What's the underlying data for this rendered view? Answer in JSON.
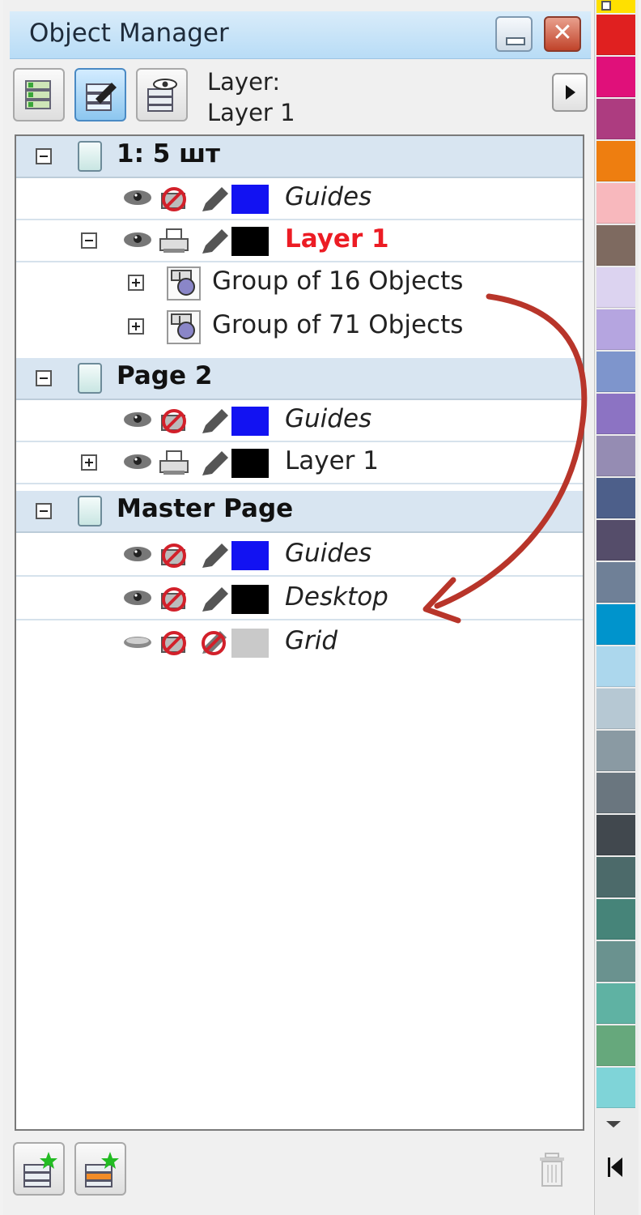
{
  "panel": {
    "title": "Object Manager",
    "close_glyph": "✕",
    "layer_prefix": "Layer:",
    "current_layer": "Layer 1"
  },
  "pages": [
    {
      "label": "1: 5 шт"
    },
    {
      "label": "Page 2"
    },
    {
      "label": "Master Page"
    }
  ],
  "layers": {
    "p1_guides": "Guides",
    "p1_layer1": "Layer 1",
    "p1_group1": "Group of 16 Objects",
    "p1_group2": "Group of 71 Objects",
    "p2_guides": "Guides",
    "p2_layer1": "Layer 1",
    "m_guides": "Guides",
    "m_desktop": "Desktop",
    "m_grid": "Grid"
  },
  "colors": {
    "guides_swatch": "#1212f2",
    "layer_swatch": "#000000",
    "grid_swatch": "#c9c9c9",
    "active_layer_text": "#ec1c24",
    "annotation_arrow": "#b8352a"
  },
  "palette": [
    "#e02020",
    "#e0107a",
    "#ad3c80",
    "#ee7e10",
    "#f8b8bd",
    "#7e6a60",
    "#dcd3f0",
    "#b5a5e0",
    "#7e95cc",
    "#8c73c3",
    "#958cb3",
    "#4d5f8a",
    "#554d6a",
    "#6f8097",
    "#0094cc",
    "#acd7ed",
    "#b6c8d3",
    "#8a9aa3",
    "#6a767f",
    "#41484e",
    "#4c6a6a",
    "#468479",
    "#6a928f",
    "#5fb2a3",
    "#66a87c",
    "#7fd4d8"
  ],
  "icons": {
    "toolbar": [
      "show-object-properties-icon",
      "edit-across-layers-icon",
      "layer-manager-view-icon"
    ],
    "bottom": [
      "new-layer-icon",
      "new-master-layer-icon",
      "delete-icon"
    ]
  }
}
